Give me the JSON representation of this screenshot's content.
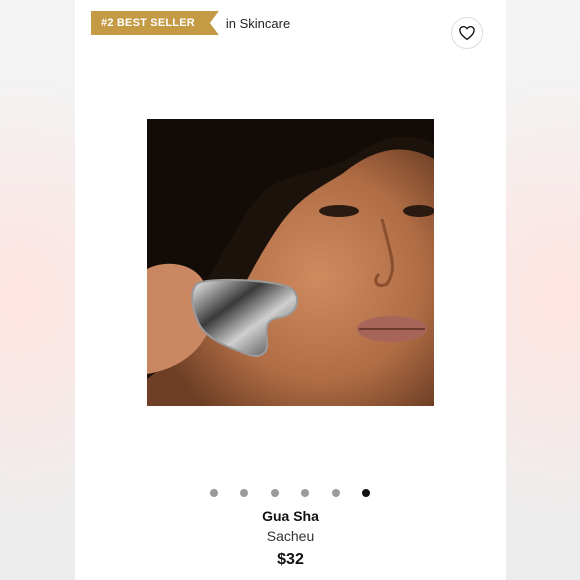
{
  "badge": {
    "label": "#2 BEST SELLER",
    "category": "in Skincare",
    "color": "#c49a45"
  },
  "favorite": {
    "icon": "heart-icon"
  },
  "gallery": {
    "image_alt": "Woman using a gua sha stone on her cheek",
    "dot_count": 6,
    "active_index": 5
  },
  "product": {
    "name": "Gua Sha",
    "brand": "Sacheu",
    "price": "$32"
  }
}
